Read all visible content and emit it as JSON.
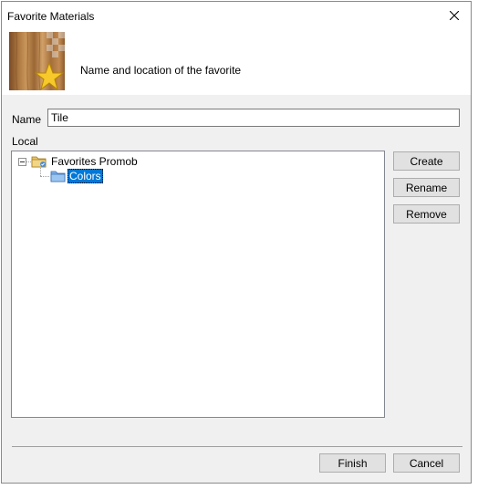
{
  "window": {
    "title": "Favorite Materials",
    "close_symbol": "×"
  },
  "header": {
    "subtitle": "Name and location of the favorite",
    "image_icon": "wood-texture-star-icon"
  },
  "form": {
    "name_label": "Name",
    "name_value": "Tile",
    "local_label": "Local"
  },
  "tree": {
    "root": {
      "label": "Favorites Promob",
      "icon": "favorites-folder-icon",
      "expanded": true
    },
    "children": [
      {
        "label": "Colors",
        "icon": "folder-icon",
        "selected": true
      }
    ]
  },
  "side_buttons": {
    "create": "Create",
    "rename": "Rename",
    "remove": "Remove"
  },
  "footer_buttons": {
    "finish": "Finish",
    "cancel": "Cancel"
  },
  "colors": {
    "selection": "#0078d7",
    "button_face": "#e1e1e1",
    "dialog_bg": "#f0f0f0"
  }
}
